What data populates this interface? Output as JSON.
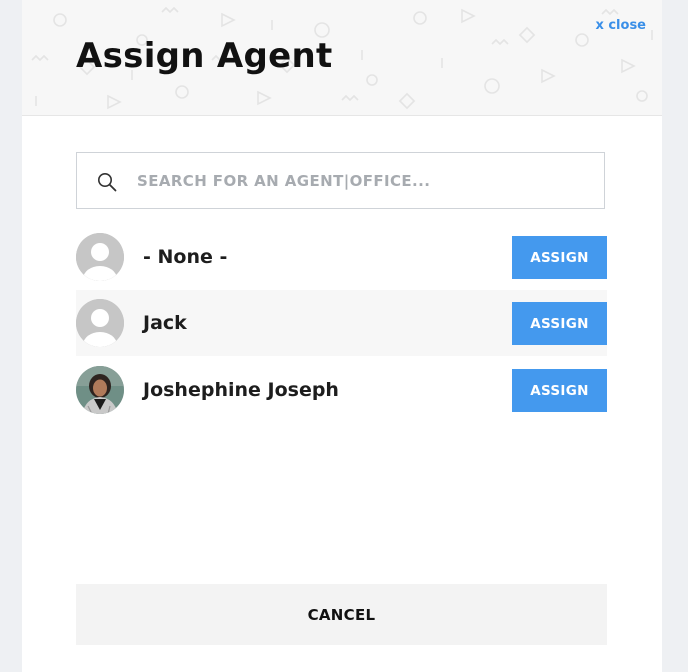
{
  "modal": {
    "title": "Assign Agent",
    "close_label": "x close"
  },
  "search": {
    "placeholder": "SEARCH FOR AN AGENT|OFFICE...",
    "value": ""
  },
  "agents": [
    {
      "name": "- None -",
      "avatar": "default-avatar",
      "button_label": "ASSIGN"
    },
    {
      "name": "Jack",
      "avatar": "default-avatar",
      "button_label": "ASSIGN"
    },
    {
      "name": "Joshephine Joseph",
      "avatar": "photo-avatar",
      "button_label": "ASSIGN"
    }
  ],
  "footer": {
    "cancel_label": "CANCEL"
  },
  "colors": {
    "accent": "#4499ee",
    "close_link": "#3a8fe8",
    "header_bg": "#f7f7f7",
    "page_bg": "#eef0f3"
  }
}
